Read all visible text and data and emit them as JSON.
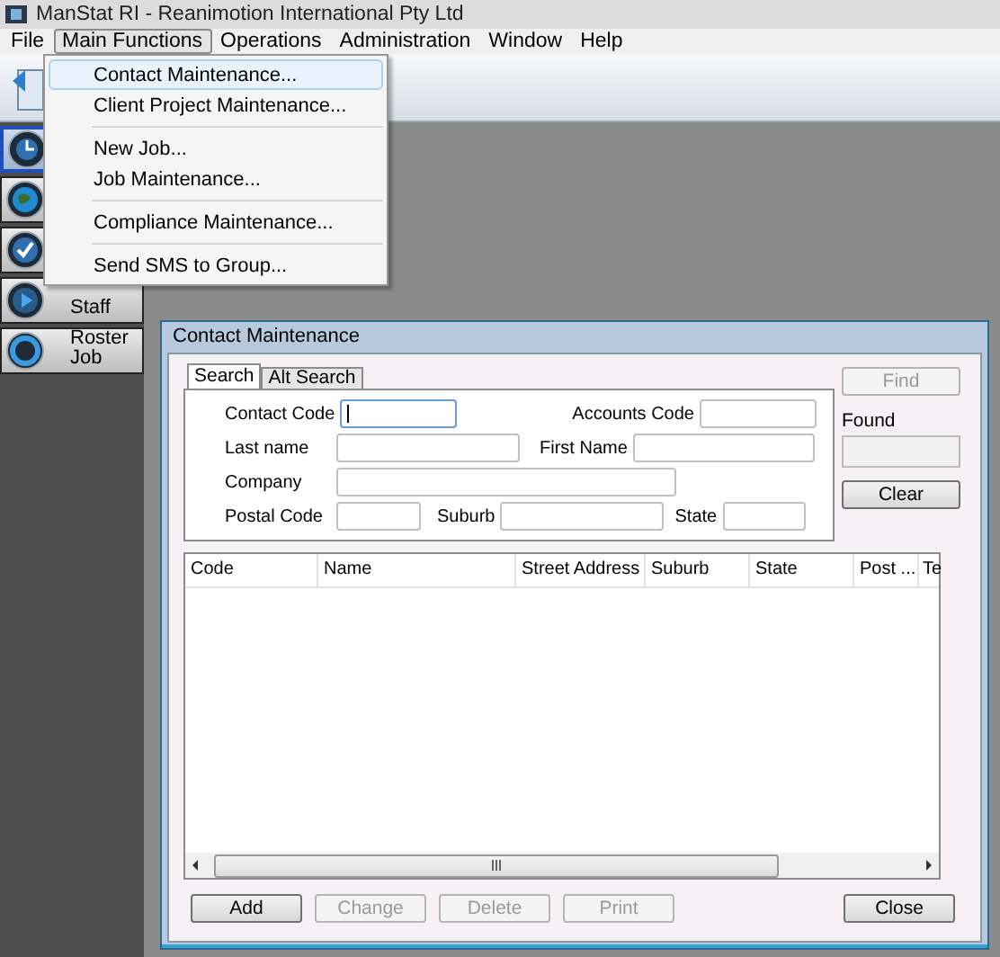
{
  "window": {
    "title": "ManStat RI - Reanimotion International Pty Ltd"
  },
  "menu_bar": [
    {
      "label": "File",
      "selected": false
    },
    {
      "label": "Main Functions",
      "selected": true
    },
    {
      "label": "Operations",
      "selected": false
    },
    {
      "label": "Administration",
      "selected": false
    },
    {
      "label": "Window",
      "selected": false
    },
    {
      "label": "Help",
      "selected": false
    }
  ],
  "open_menu": {
    "items": [
      {
        "kind": "item",
        "label": "Contact Maintenance...",
        "selected": true
      },
      {
        "kind": "item",
        "label": "Client Project Maintenance...",
        "selected": false
      },
      {
        "kind": "separator"
      },
      {
        "kind": "item",
        "label": "New Job...",
        "selected": false
      },
      {
        "kind": "item",
        "label": "Job Maintenance...",
        "selected": false
      },
      {
        "kind": "separator"
      },
      {
        "kind": "item",
        "label": "Compliance Maintenance...",
        "selected": false
      },
      {
        "kind": "separator"
      },
      {
        "kind": "item",
        "label": "Send SMS to Group...",
        "selected": false
      }
    ]
  },
  "sidebar": {
    "items": [
      {
        "selected": true
      },
      {
        "selected": false
      },
      {
        "selected": false
      },
      {
        "label": "Staff",
        "selected": false
      },
      {
        "label": "Roster Job",
        "selected": false
      }
    ]
  },
  "dialog": {
    "title": "Contact Maintenance",
    "tabs": [
      {
        "label": "Search",
        "selected": true
      },
      {
        "label": "Alt Search",
        "selected": false
      }
    ],
    "form_rows": [
      [
        {
          "label": "Contact Code",
          "focused": true
        },
        {
          "label": "Accounts Code",
          "focused": false
        }
      ],
      [
        {
          "label": "Last name",
          "focused": false
        },
        {
          "label": "First Name",
          "focused": false
        }
      ],
      [
        {
          "label": "Company",
          "focused": false
        }
      ],
      [
        {
          "label": "Postal Code",
          "focused": false
        },
        {
          "label": "Suburb",
          "focused": false
        },
        {
          "label": "State",
          "focused": false
        }
      ]
    ],
    "find_button": {
      "label": "Find",
      "disabled": true
    },
    "found": {
      "label": "Found"
    },
    "clear_button": {
      "label": "Clear",
      "disabled": false
    },
    "table": {
      "columns": [
        "Code",
        "Name",
        "Street Address",
        "Suburb",
        "State",
        "Post ...",
        "Te"
      ]
    },
    "buttons": [
      {
        "label": "Add",
        "disabled": false
      },
      {
        "label": "Change",
        "disabled": true
      },
      {
        "label": "Delete",
        "disabled": true
      },
      {
        "label": "Print",
        "disabled": true
      }
    ],
    "close_button": {
      "label": "Close",
      "disabled": false
    }
  }
}
